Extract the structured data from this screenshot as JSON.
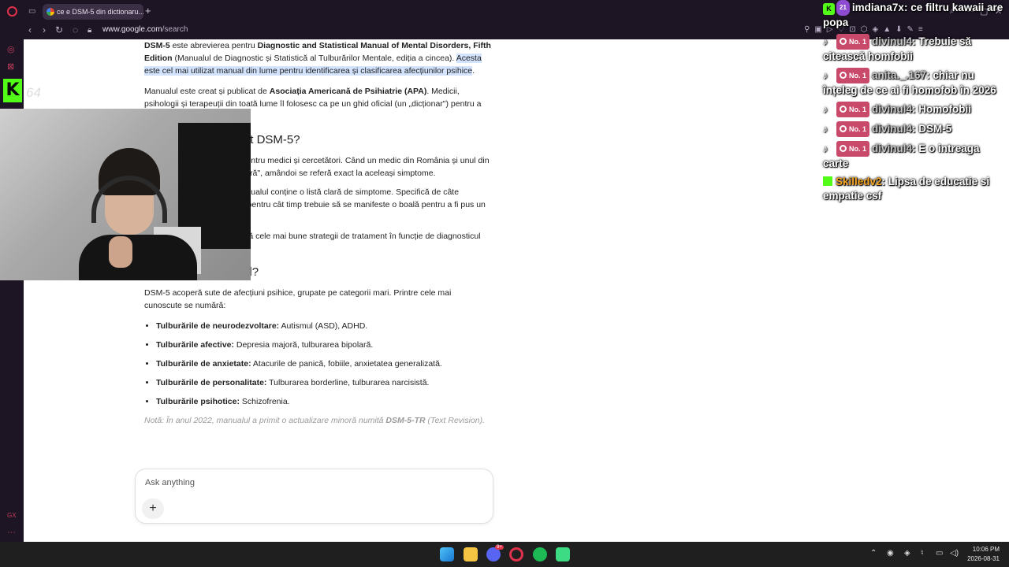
{
  "browser": {
    "tab_title": "ce e DSM-5 din dictionaru...",
    "new_tab_glyph": "+",
    "url_host": "www.google.com",
    "url_path": "/search"
  },
  "article": {
    "p1_b1": "DSM-5",
    "p1_t1": " este abrevierea pentru ",
    "p1_b2": "Diagnostic and Statistical Manual of Mental Disorders, Fifth Edition",
    "p1_t2": " (Manualul de Diagnostic și Statistică al Tulburărilor Mentale, ediția a cincea).",
    "p1_hl": "Acesta este cel mai utilizat manual din lume pentru identificarea și clasificarea afecțiunilor psihice",
    "p1_end": ".",
    "p2_t1": "Manualul este creat și publicat de ",
    "p2_b1": "Asociația Americană de Psihiatrie (APA)",
    "p2_t2": ". Medicii, psihologii și terapeuții din toată lume îl folosesc ca pe un ghid oficial (un „dicționar\") pentru a pune diagnostice corecte.",
    "h_why": "De ce este important DSM-5?",
    "why1": "Oferă un limbaj comun pentru medici și cercetători. Când un medic din România și unul din SUA spun „depresie majoră\", amândoi se referă exact la aceleași simptome.",
    "why2": "Pentru fiecare boală, manualul conține o listă clară de simptome. Specifică de câte simptome este nevoie și pentru cât timp trebuie să se manifeste o boală pentru a fi pus un diagnostic oficial.",
    "why3": "Ajută specialiștii să aleagă cele mai bune strategii de tratament în funcție de diagnosticul precis.",
    "h_contents": "Ce conține manualul?",
    "contents_intro": "DSM-5 acoperă sute de afecțiuni psihice, grupate pe categorii mari. Printre cele mai cunoscute se numără:",
    "categories": [
      {
        "name": "Tulburările de neurodezvoltare:",
        "desc": " Autismul (ASD), ADHD."
      },
      {
        "name": "Tulburările afective:",
        "desc": " Depresia majoră, tulburarea bipolară."
      },
      {
        "name": "Tulburările de anxietate:",
        "desc": " Atacurile de panică, fobiile, anxietatea generalizată."
      },
      {
        "name": "Tulburările de personalitate:",
        "desc": " Tulburarea borderline, tulburarea narcisistă."
      },
      {
        "name": "Tulburările psihotice:",
        "desc": " Schizofrenia."
      }
    ],
    "note_t1": "Notă: În anul 2022, manualul a primit o actualizare minoră numită ",
    "note_b1": "DSM-5-TR",
    "note_t2": " (Text Revision)."
  },
  "ask": {
    "placeholder": "Ask anything",
    "plus": "+"
  },
  "overlay": {
    "kick_logo": "K",
    "kick_count": "64"
  },
  "chat": [
    {
      "platform": "kick",
      "level": "21",
      "user": "imdiana7x",
      "text": "ce filtru kawaii are popa"
    },
    {
      "platform": "tiktok",
      "badge": "No. 1",
      "user": "divinul4",
      "text": "Trebuie să citească homfobii"
    },
    {
      "platform": "tiktok",
      "badge": "No. 1",
      "user": "anita._.167",
      "text": "chiar nu înțeleg de ce ai fi homofob în 2026"
    },
    {
      "platform": "tiktok",
      "badge": "No. 1",
      "user": "divinul4",
      "text": "Homofobii"
    },
    {
      "platform": "tiktok",
      "badge": "No. 1",
      "user": "divinul4",
      "text": "DSM-5"
    },
    {
      "platform": "tiktok",
      "badge": "No. 1",
      "user": "divinul4",
      "text": "E o intreaga carte"
    },
    {
      "platform": "kick",
      "user": "Skilledv2",
      "text": "Lipsa de educatie si empatie csf"
    }
  ],
  "taskbar": {
    "time": "10:06 PM",
    "date": "2026-08-31",
    "discord_badge": "9+"
  },
  "colors": {
    "accent_opera": "#e0314b",
    "kick_green": "#53fc18",
    "highlight": "#d3e3fd"
  }
}
